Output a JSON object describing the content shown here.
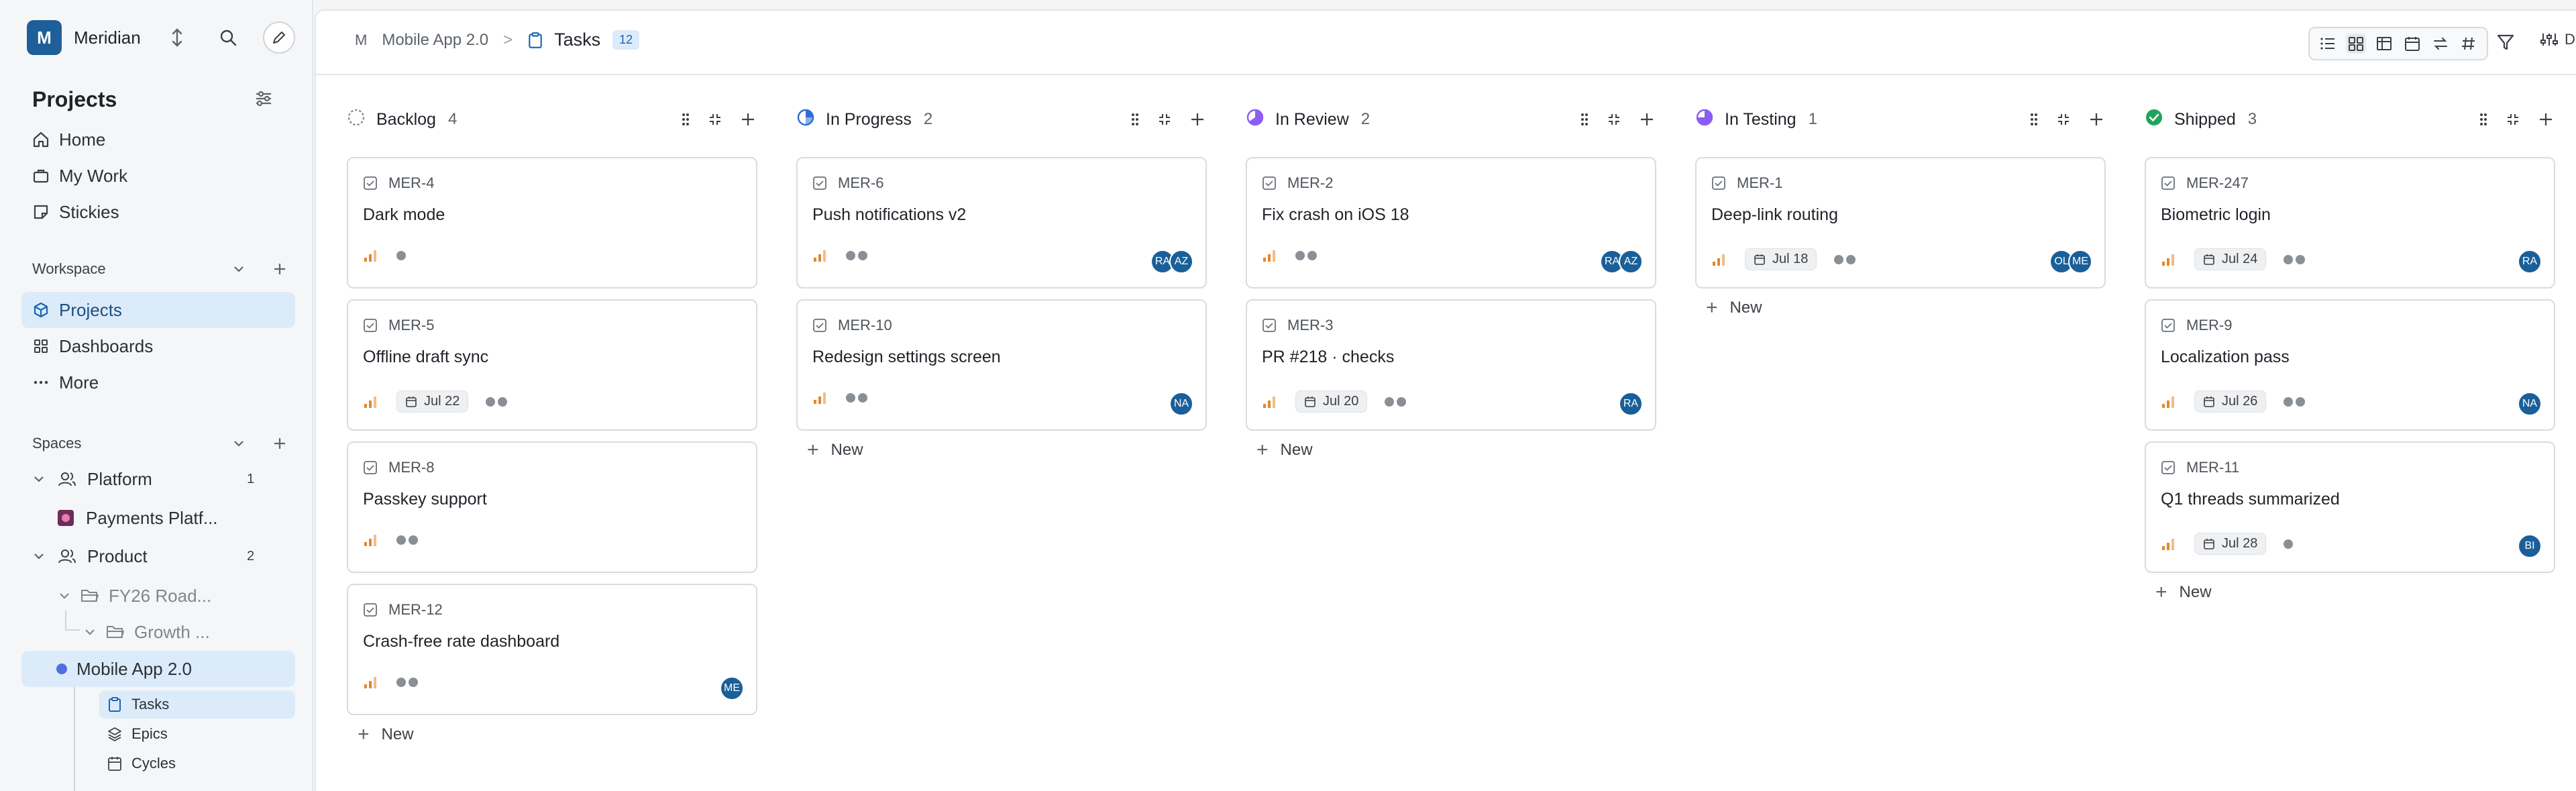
{
  "workspace": {
    "logo_letter": "M",
    "name": "Meridian"
  },
  "projects_section": {
    "title": "Projects"
  },
  "main_nav": [
    {
      "label": "Home",
      "icon": "home-icon"
    },
    {
      "label": "My Work",
      "icon": "briefcase-icon"
    },
    {
      "label": "Stickies",
      "icon": "sticky-note-icon"
    }
  ],
  "workspace_group": {
    "label": "Workspace",
    "items": [
      {
        "label": "Projects",
        "icon": "cube-icon",
        "active": true
      },
      {
        "label": "Dashboards",
        "icon": "grid-icon"
      },
      {
        "label": "More",
        "icon": "more-icon"
      }
    ]
  },
  "spaces_group": {
    "label": "Spaces",
    "tree": [
      {
        "label": "Platform",
        "count": "1"
      },
      {
        "label": "Payments Platf..."
      },
      {
        "label": "Product",
        "count": "2"
      },
      {
        "label": "FY26 Road..."
      },
      {
        "label": "Growth ..."
      },
      {
        "label": "Mobile App 2.0"
      }
    ],
    "sub_items": [
      {
        "label": "Tasks",
        "active": true
      },
      {
        "label": "Epics"
      },
      {
        "label": "Cycles"
      }
    ]
  },
  "breadcrumb": {
    "logo_letter": "M",
    "project": "Mobile App 2.0",
    "separator": ">",
    "current": "Tasks",
    "count": "12"
  },
  "toolbar": {
    "display_label": "D"
  },
  "new_label": "New",
  "colors": {
    "accent": "#1e5f99",
    "active_bg": "#dcebfa",
    "avatar": "#1a5f99",
    "shipped": "#22a35a",
    "in_progress": "#2f6fd1",
    "in_review": "#8b5cf6",
    "priority": "#e0892b"
  },
  "columns": [
    {
      "name": "Backlog",
      "count": "4",
      "status_icon": "backlog-dashed-circle-icon",
      "cards": [
        {
          "id": "MER-4",
          "title": "Dark mode",
          "date": "",
          "dots": 1,
          "avatars": []
        },
        {
          "id": "MER-5",
          "title": "Offline draft sync",
          "date": "Jul 22",
          "dots": 2,
          "avatars": []
        },
        {
          "id": "MER-8",
          "title": "Passkey support",
          "date": "",
          "dots": 2,
          "avatars": []
        },
        {
          "id": "MER-12",
          "title": "Crash-free rate dashboard",
          "date": "",
          "dots": 2,
          "avatars": [
            "ME"
          ]
        }
      ]
    },
    {
      "name": "In Progress",
      "count": "2",
      "status_icon": "in-progress-half-circle-icon",
      "cards": [
        {
          "id": "MER-6",
          "title": "Push notifications v2",
          "date": "",
          "dots": 2,
          "avatars": [
            "RA",
            "AZ"
          ]
        },
        {
          "id": "MER-10",
          "title": "Redesign settings screen",
          "date": "",
          "dots": 2,
          "avatars": [
            "NA"
          ]
        }
      ]
    },
    {
      "name": "In Review",
      "count": "2",
      "status_icon": "in-review-circle-icon",
      "cards": [
        {
          "id": "MER-2",
          "title": "Fix crash on iOS 18",
          "date": "",
          "dots": 2,
          "avatars": [
            "RA",
            "AZ"
          ]
        },
        {
          "id": "MER-3",
          "title": "PR #218 · checks",
          "date": "Jul 20",
          "dots": 2,
          "avatars": [
            "RA"
          ]
        }
      ]
    },
    {
      "name": "In Testing",
      "count": "1",
      "status_icon": "in-testing-circle-icon",
      "cards": [
        {
          "id": "MER-1",
          "title": "Deep-link routing",
          "date": "Jul 18",
          "dots": 2,
          "avatars": [
            "OL",
            "ME"
          ]
        }
      ]
    },
    {
      "name": "Shipped",
      "count": "3",
      "status_icon": "shipped-check-circle-icon",
      "cards": [
        {
          "id": "MER-247",
          "title": "Biometric login",
          "date": "Jul 24",
          "dots": 2,
          "avatars": [
            "RA"
          ]
        },
        {
          "id": "MER-9",
          "title": "Localization pass",
          "date": "Jul 26",
          "dots": 2,
          "avatars": [
            "NA"
          ]
        },
        {
          "id": "MER-11",
          "title": "Q1 threads summarized",
          "date": "Jul 28",
          "dots": 1,
          "avatars": [
            "BI"
          ]
        }
      ]
    }
  ]
}
